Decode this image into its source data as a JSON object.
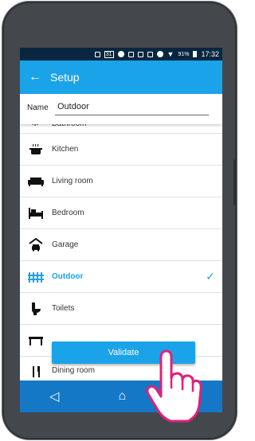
{
  "status_bar": {
    "icons": [
      "message-icon",
      "calendar-icon",
      "notification-icon",
      "app-icon",
      "app-icon",
      "app-icon",
      "do-not-disturb-icon",
      "wifi-icon",
      "signal-icon"
    ],
    "calendar_day": "31",
    "battery": "91%",
    "time": "17:32"
  },
  "app_bar": {
    "back_icon": "arrow-left-icon",
    "title": "Setup"
  },
  "name_field": {
    "label": "Name",
    "value": "Outdoor"
  },
  "rooms": [
    {
      "label": "Bathroom",
      "icon": "shower-icon",
      "selected": false
    },
    {
      "label": "Kitchen",
      "icon": "pot-icon",
      "selected": false
    },
    {
      "label": "Living room",
      "icon": "sofa-icon",
      "selected": false
    },
    {
      "label": "Bedroom",
      "icon": "bed-icon",
      "selected": false
    },
    {
      "label": "Garage",
      "icon": "garage-car-icon",
      "selected": false
    },
    {
      "label": "Outdoor",
      "icon": "fence-icon",
      "selected": true
    },
    {
      "label": "Toilets",
      "icon": "toilet-icon",
      "selected": false
    },
    {
      "label": "",
      "icon": "table-icon",
      "selected": false
    },
    {
      "label": "Dining room",
      "icon": "fork-knife-icon",
      "selected": false
    }
  ],
  "validate_button": {
    "label": "Validate"
  },
  "nav_bar": {
    "items": [
      "back-triangle-icon",
      "home-icon",
      "recents-square-icon"
    ]
  },
  "colors": {
    "accent": "#1aa3e8",
    "status_bar": "#08263f",
    "nav_bar": "#1478c6",
    "hand_outline": "#e0207a"
  }
}
